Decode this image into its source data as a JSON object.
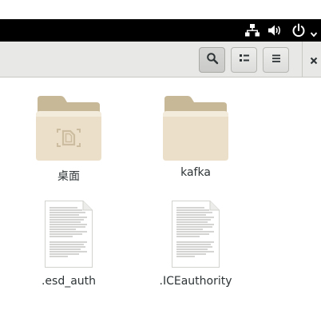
{
  "files": [
    {
      "name": "桌面",
      "icon": "folder-desktop-icon"
    },
    {
      "name": "kafka",
      "icon": "folder-icon"
    },
    {
      "name": ".esd_auth",
      "icon": "text-document-icon"
    },
    {
      "name": ".ICEauthority",
      "icon": "text-document-icon"
    }
  ],
  "colors": {
    "topbar": "#000000",
    "headerbar": "#e8e8e7",
    "folder_back": "#c7b898",
    "folder_front": "#ebdfc9",
    "document": "#ffffff"
  }
}
